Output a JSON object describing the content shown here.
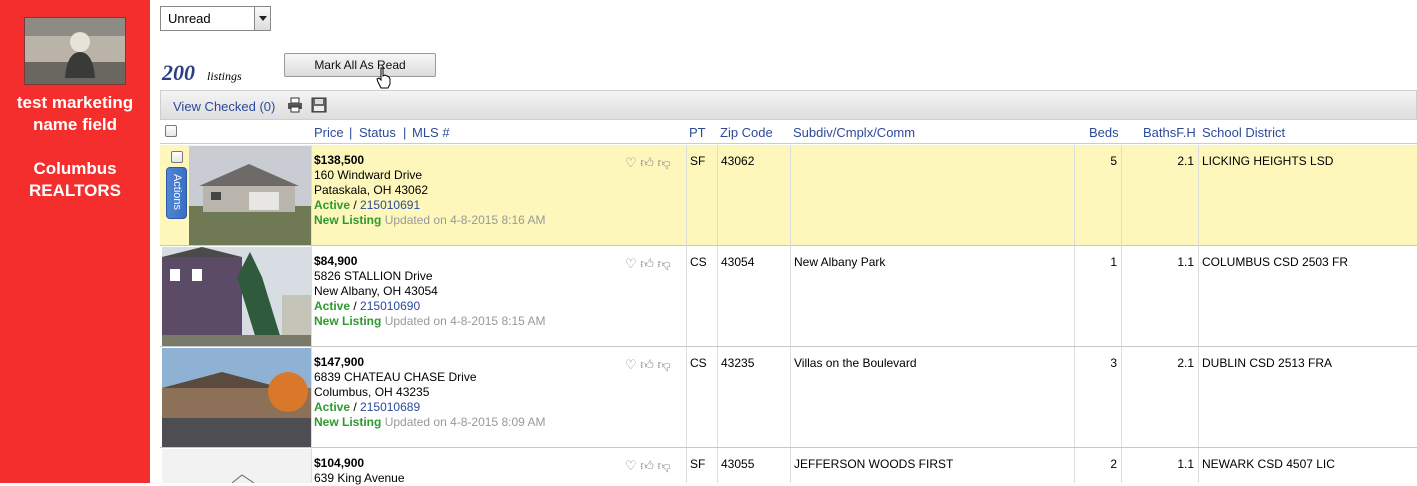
{
  "sidebar": {
    "name": "test marketing name field",
    "name_line1": "test marketing",
    "name_line2": "name field",
    "org_line1": "Columbus",
    "org_line2": "REALTORS"
  },
  "filter": {
    "selected": "Unread"
  },
  "listing_count": {
    "number": "200",
    "label": "listings"
  },
  "mark_all_button": "Mark All As Read",
  "toolbar": {
    "view_checked": "View Checked (0)"
  },
  "columns": {
    "price": "Price",
    "status": "Status",
    "mls": "MLS #",
    "sep": "|",
    "pt": "PT",
    "zip": "Zip Code",
    "subdiv": "Subdiv/Cmplx/Comm",
    "beds": "Beds",
    "baths": "BathsF.H",
    "school": "School District"
  },
  "actions_label": "Actions",
  "listings": [
    {
      "price": "$138,500",
      "address": "160 Windward Drive",
      "city": "Pataskala, OH 43062",
      "status": "Active",
      "mls": "215010691",
      "new_label": "New Listing",
      "updated": "Updated on 4-8-2015 8:16 AM",
      "pt": "SF",
      "zip": "43062",
      "subdiv": "",
      "beds": "5",
      "baths": "2.1",
      "school": "LICKING HEIGHTS LSD"
    },
    {
      "price": "$84,900",
      "address": "5826 STALLION Drive",
      "city": "New Albany, OH 43054",
      "status": "Active",
      "mls": "215010690",
      "new_label": "New Listing",
      "updated": "Updated on 4-8-2015 8:15 AM",
      "pt": "CS",
      "zip": "43054",
      "subdiv": "New Albany Park",
      "beds": "1",
      "baths": "1.1",
      "school": "COLUMBUS CSD 2503 FR"
    },
    {
      "price": "$147,900",
      "address": "6839 CHATEAU CHASE Drive",
      "city": "Columbus, OH 43235",
      "status": "Active",
      "mls": "215010689",
      "new_label": "New Listing",
      "updated": "Updated on 4-8-2015 8:09 AM",
      "pt": "CS",
      "zip": "43235",
      "subdiv": "Villas on the Boulevard",
      "beds": "3",
      "baths": "2.1",
      "school": "DUBLIN CSD 2513 FRA"
    },
    {
      "price": "$104,900",
      "address": "639 King Avenue",
      "pt": "SF",
      "zip": "43055",
      "subdiv": "JEFFERSON WOODS FIRST",
      "beds": "2",
      "baths": "1.1",
      "school": "NEWARK CSD 4507 LIC"
    }
  ],
  "colors": {
    "sidebar": "#f42d2d",
    "highlight_row": "#fdf7bc",
    "link": "#2c4a9a",
    "active_green": "#2e9a2e"
  }
}
